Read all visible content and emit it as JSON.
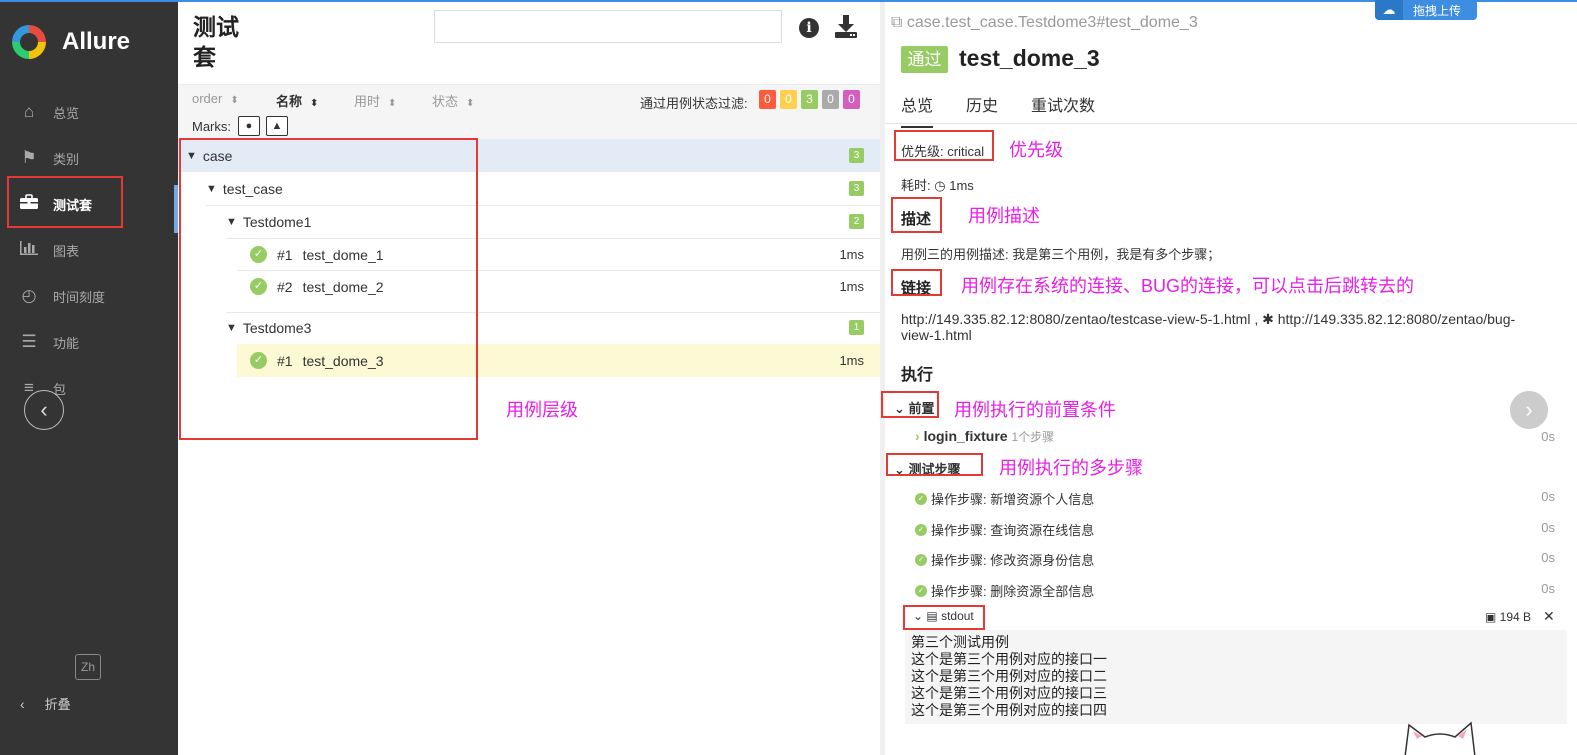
{
  "app": {
    "name": "Allure"
  },
  "sidebar": {
    "items": [
      {
        "label": "总览",
        "icon": "home-icon"
      },
      {
        "label": "类别",
        "icon": "flag-icon"
      },
      {
        "label": "测试套",
        "icon": "briefcase-icon"
      },
      {
        "label": "图表",
        "icon": "bar-chart-icon"
      },
      {
        "label": "时间刻度",
        "icon": "clock-icon"
      },
      {
        "label": "功能",
        "icon": "list-icon"
      },
      {
        "label": "包",
        "icon": "align-left-icon"
      }
    ],
    "lang": "Zh",
    "collapse_label": "折叠"
  },
  "suites": {
    "title": "测试套",
    "search": {
      "value": "",
      "placeholder": ""
    },
    "sort": {
      "order": "order",
      "name": "名称",
      "duration": "用时",
      "status": "状态"
    },
    "filter_label": "通过用例状态过滤:",
    "filter_counts": [
      "0",
      "0",
      "3",
      "0",
      "0"
    ],
    "filter_colors": [
      "#fd5a3e",
      "#ffd050",
      "#97cc64",
      "#aaaaaa",
      "#d35ebe"
    ],
    "marks_label": "Marks:",
    "tree": {
      "case": {
        "label": "case",
        "count": "3"
      },
      "test_case": {
        "label": "test_case",
        "count": "3"
      },
      "testdome1": {
        "label": "Testdome1",
        "count": "2"
      },
      "t1": {
        "num": "#1",
        "name": "test_dome_1",
        "duration": "1ms"
      },
      "t2": {
        "num": "#2",
        "name": "test_dome_2",
        "duration": "1ms"
      },
      "testdome3": {
        "label": "Testdome3",
        "count": "1"
      },
      "t3": {
        "num": "#1",
        "name": "test_dome_3",
        "duration": "1ms"
      }
    },
    "annotation": "用例层级"
  },
  "detail": {
    "breadcrumb": "case.test_case.Testdome3#test_dome_3",
    "status": "通过",
    "title": "test_dome_3",
    "tabs": [
      "总览",
      "历史",
      "重试次数"
    ],
    "severity_label": "优先级",
    "severity_value": "critical",
    "severity_annotation": "优先级",
    "duration_label": "耗时:",
    "duration_value": "1ms",
    "description_header": "描述",
    "description_annotation": "用例描述",
    "description_text": "用例三的用例描述: 我是第三个用例，我是有多个步骤；",
    "links_header": "链接",
    "links_annotation": "用例存在系统的连接、BUG的连接，可以点击后跳转去的",
    "link1": "http://149.335.82.12:8080/zentao/testcase-view-5-1.html",
    "link2": "http://149.335.82.12:8080/zentao/bug-view-1.html",
    "execution_header": "执行",
    "setup_header": "前置",
    "setup_annotation": "用例执行的前置条件",
    "fixture_name": "login_fixture",
    "fixture_steps": "1个步骤",
    "fixture_time": "0s",
    "steps_header": "测试步骤",
    "steps_annotation": "用例执行的多步骤",
    "steps": [
      {
        "label": "操作步骤: 新增资源个人信息",
        "time": "0s"
      },
      {
        "label": "操作步骤: 查询资源在线信息",
        "time": "0s"
      },
      {
        "label": "操作步骤: 修改资源身份信息",
        "time": "0s"
      },
      {
        "label": "操作步骤: 删除资源全部信息",
        "time": "0s"
      }
    ],
    "stdout_label": "stdout",
    "stdout_size": "194 B",
    "stdout_lines": [
      "第三个测试用例",
      "这个是第三个用例对应的接口一",
      "这个是第三个用例对应的接口二",
      "这个是第三个用例对应的接口三",
      "这个是第三个用例对应的接口四"
    ]
  },
  "overlay": {
    "upload_label": "拖拽上传"
  }
}
